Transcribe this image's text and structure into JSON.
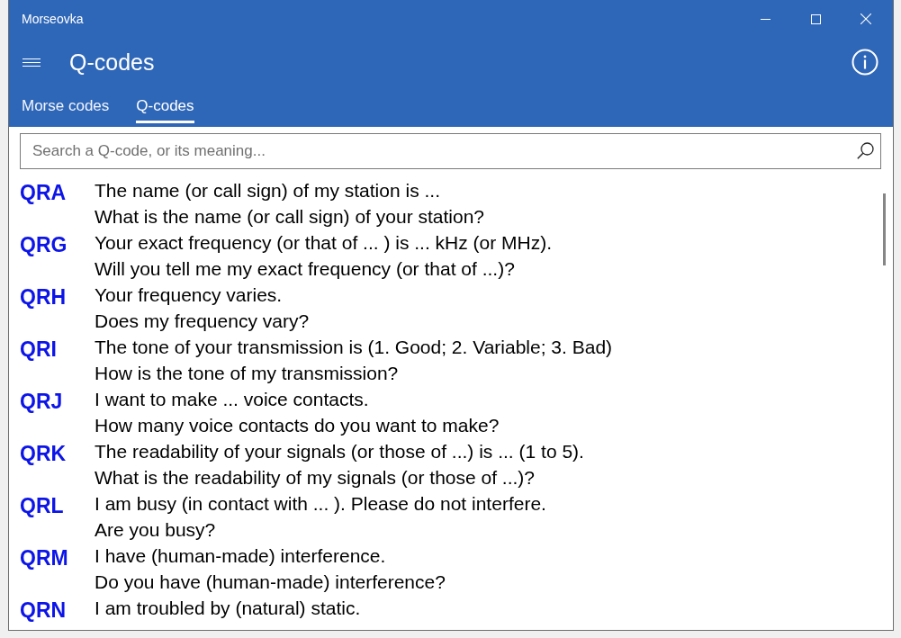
{
  "window": {
    "title": "Morseovka"
  },
  "header": {
    "title": "Q-codes"
  },
  "tabs": [
    {
      "label": "Morse codes",
      "selected": false
    },
    {
      "label": "Q-codes",
      "selected": true
    }
  ],
  "search": {
    "placeholder": "Search a Q-code, or its meaning..."
  },
  "q_codes": [
    {
      "code": "QRA",
      "answer": "The name (or call sign) of my station is ...",
      "question": "What is the name (or call sign) of your station?"
    },
    {
      "code": "QRG",
      "answer": "Your exact frequency (or that of ... ) is ... kHz (or MHz).",
      "question": "Will you tell me my exact frequency (or that of ...)?"
    },
    {
      "code": "QRH",
      "answer": "Your frequency varies.",
      "question": "Does my frequency vary?"
    },
    {
      "code": "QRI",
      "answer": "The tone of your transmission is (1. Good; 2. Variable; 3. Bad)",
      "question": "How is the tone of my transmission?"
    },
    {
      "code": "QRJ",
      "answer": "I want to make ... voice contacts.",
      "question": "How many voice contacts do you want to make?"
    },
    {
      "code": "QRK",
      "answer": "The readability of your signals (or those of ...) is ... (1 to 5).",
      "question": "What is the readability of my signals (or those of ...)?"
    },
    {
      "code": "QRL",
      "answer": "I am busy (in contact with ... ). Please do not interfere.",
      "question": "Are you busy?"
    },
    {
      "code": "QRM",
      "answer": "I have (human-made) interference.",
      "question": "Do you have (human-made) interference?"
    },
    {
      "code": "QRN",
      "answer": "I am troubled by (natural) static."
    }
  ]
}
